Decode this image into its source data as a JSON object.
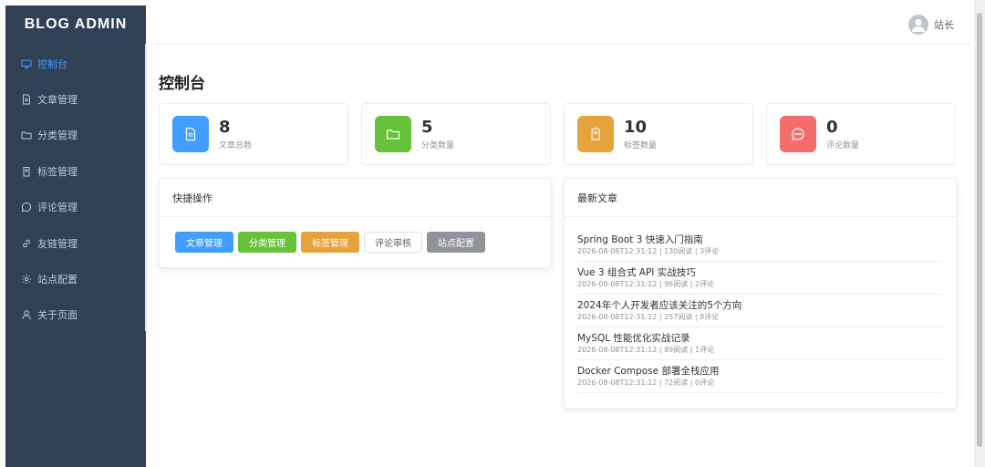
{
  "sidebar": {
    "brand": "BLOG ADMIN",
    "items": [
      {
        "label": "控制台",
        "icon": "monitor-icon",
        "active": true
      },
      {
        "label": "文章管理",
        "icon": "document-icon",
        "active": false
      },
      {
        "label": "分类管理",
        "icon": "folder-icon",
        "active": false
      },
      {
        "label": "标签管理",
        "icon": "tag-icon",
        "active": false
      },
      {
        "label": "评论管理",
        "icon": "chat-icon",
        "active": false
      },
      {
        "label": "友链管理",
        "icon": "link-icon",
        "active": false
      },
      {
        "label": "站点配置",
        "icon": "gear-icon",
        "active": false
      },
      {
        "label": "关于页面",
        "icon": "user-icon",
        "active": false
      }
    ]
  },
  "header": {
    "user_name": "站长",
    "avatar_icon": "user-avatar-icon"
  },
  "page": {
    "title": "控制台"
  },
  "stats": [
    {
      "value": "8",
      "label": "文章总数",
      "icon": "document-icon",
      "color": "#409eff"
    },
    {
      "value": "5",
      "label": "分类数量",
      "icon": "folder-icon",
      "color": "#67c23a"
    },
    {
      "value": "10",
      "label": "标签数量",
      "icon": "tag-icon",
      "color": "#e6a23c"
    },
    {
      "value": "0",
      "label": "评论数量",
      "icon": "chat-icon",
      "color": "#f56c6c"
    }
  ],
  "quick_actions": {
    "title": "快捷操作",
    "buttons": [
      {
        "label": "文章管理",
        "color": "#409eff"
      },
      {
        "label": "分类管理",
        "color": "#67c23a"
      },
      {
        "label": "标签管理",
        "color": "#e6a23c"
      },
      {
        "label": "评论审核",
        "color": "#ffffff"
      },
      {
        "label": "站点配置",
        "color": "#909399"
      }
    ]
  },
  "latest_articles": {
    "title": "最新文章",
    "items": [
      {
        "title": "Spring Boot 3 快速入门指南",
        "meta": "2026-08-08T12:31:12 | 130阅读 | 3评论"
      },
      {
        "title": "Vue 3 组合式 API 实战技巧",
        "meta": "2026-08-08T12:31:12 | 96阅读 | 2评论"
      },
      {
        "title": "2024年个人开发者应该关注的5个方向",
        "meta": "2026-08-08T12:31:12 | 257阅读 | 8评论"
      },
      {
        "title": "MySQL 性能优化实战记录",
        "meta": "2026-08-08T12:31:12 | 89阅读 | 1评论"
      },
      {
        "title": "Docker Compose 部署全栈应用",
        "meta": "2026-08-08T12:31:12 | 72阅读 | 0评论"
      }
    ]
  },
  "colors": {
    "sidebar_bg": "#304156",
    "sidebar_text": "#bfcbd9",
    "accent": "#409eff"
  }
}
